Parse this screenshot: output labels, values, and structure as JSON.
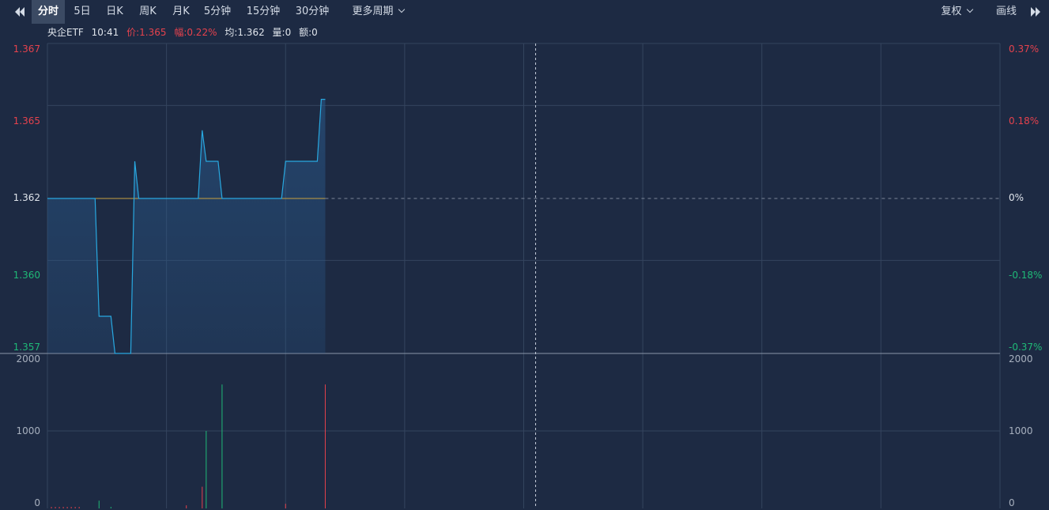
{
  "toolbar": {
    "tabs": [
      {
        "label": "分时",
        "active": true
      },
      {
        "label": "5日",
        "active": false
      },
      {
        "label": "日K",
        "active": false
      },
      {
        "label": "周K",
        "active": false
      },
      {
        "label": "月K",
        "active": false
      },
      {
        "label": "5分钟",
        "active": false
      },
      {
        "label": "15分钟",
        "active": false
      },
      {
        "label": "30分钟",
        "active": false
      }
    ],
    "more_periods": "更多周期",
    "adjust": "复权",
    "draw": "画线"
  },
  "quote": {
    "name": "央企ETF",
    "time": "10:41",
    "price_label": "价:",
    "price": "1.365",
    "change_label": "幅:",
    "change": "0.22%",
    "avg_label": "均:",
    "avg": "1.362",
    "volume_label": "量:",
    "volume": "0",
    "amount_label": "额:",
    "amount": "0"
  },
  "colors": {
    "background": "#1d2a43",
    "price_line": "#28a8e0",
    "avg_line": "#c8a040",
    "up": "#e5424d",
    "down": "#1fb977",
    "grid": "#34445e"
  },
  "chart_data": {
    "type": "line",
    "title": "",
    "price_axis": {
      "ticks_left": [
        "1.367",
        "1.365",
        "1.362",
        "1.360",
        "1.357"
      ],
      "ticks_right": [
        "0.37%",
        "0.18%",
        "0%",
        "-0.18%",
        "-0.37%"
      ],
      "ylim": [
        1.357,
        1.367
      ],
      "prev_close": 1.362
    },
    "volume_axis": {
      "ticks_left": [
        "2000",
        "1000",
        "0"
      ],
      "ticks_right": [
        "2000",
        "1000",
        "0"
      ],
      "ylim": [
        0,
        2000
      ]
    },
    "total_minutes": 240,
    "series": [
      {
        "values": [
          1.362,
          1.362,
          1.362,
          1.362,
          1.362,
          1.362,
          1.362,
          1.362,
          1.362,
          1.362,
          1.362,
          1.362,
          1.362,
          1.3582,
          1.3582,
          1.3582,
          1.3582,
          1.357,
          1.357,
          1.357,
          1.357,
          1.357,
          1.3632,
          1.362,
          1.362,
          1.362,
          1.362,
          1.362,
          1.362,
          1.362,
          1.362,
          1.362,
          1.362,
          1.362,
          1.362,
          1.362,
          1.362,
          1.362,
          1.362,
          1.3642,
          1.3632,
          1.3632,
          1.3632,
          1.3632,
          1.362,
          1.362,
          1.362,
          1.362,
          1.362,
          1.362,
          1.362,
          1.362,
          1.362,
          1.362,
          1.362,
          1.362,
          1.362,
          1.362,
          1.362,
          1.362,
          1.3632,
          1.3632,
          1.3632,
          1.3632,
          1.3632,
          1.3632,
          1.3632,
          1.3632,
          1.3632,
          1.3652,
          1.3652
        ]
      },
      {
        "values_note_avg": 1.362
      }
    ],
    "volume": [
      {
        "minute": 1,
        "value": 20,
        "dir": "up"
      },
      {
        "minute": 2,
        "value": 20,
        "dir": "up"
      },
      {
        "minute": 3,
        "value": 20,
        "dir": "up"
      },
      {
        "minute": 4,
        "value": 20,
        "dir": "up"
      },
      {
        "minute": 5,
        "value": 20,
        "dir": "up"
      },
      {
        "minute": 6,
        "value": 20,
        "dir": "up"
      },
      {
        "minute": 7,
        "value": 20,
        "dir": "up"
      },
      {
        "minute": 8,
        "value": 20,
        "dir": "up"
      },
      {
        "minute": 13,
        "value": 100,
        "dir": "down"
      },
      {
        "minute": 16,
        "value": 20,
        "dir": "down"
      },
      {
        "minute": 35,
        "value": 40,
        "dir": "up"
      },
      {
        "minute": 39,
        "value": 280,
        "dir": "up"
      },
      {
        "minute": 40,
        "value": 1000,
        "dir": "down"
      },
      {
        "minute": 44,
        "value": 1600,
        "dir": "down"
      },
      {
        "minute": 60,
        "value": 60,
        "dir": "up"
      },
      {
        "minute": 70,
        "value": 1600,
        "dir": "up"
      }
    ]
  }
}
